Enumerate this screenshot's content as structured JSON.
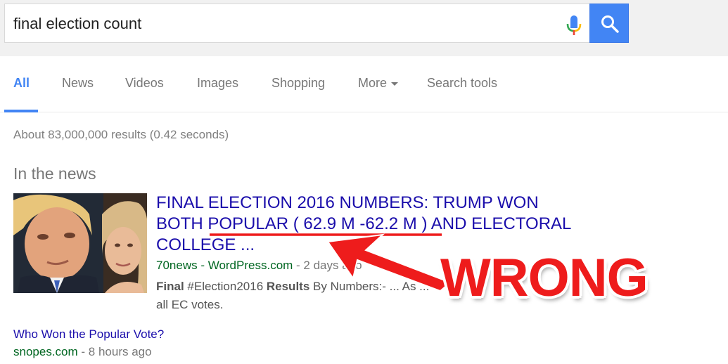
{
  "search": {
    "query": "final election count",
    "mic_icon": "microphone-icon",
    "search_icon": "magnifier-icon",
    "colors": {
      "button": "#4285f4",
      "accent": "#4285f4"
    }
  },
  "tabs": [
    {
      "label": "All",
      "active": true
    },
    {
      "label": "News"
    },
    {
      "label": "Videos"
    },
    {
      "label": "Images"
    },
    {
      "label": "Shopping"
    },
    {
      "label": "More"
    },
    {
      "label": "Search tools"
    }
  ],
  "results_stats": "About 83,000,000 results (0.42 seconds)",
  "in_the_news": {
    "heading": "In the news",
    "top_story": {
      "title_line1": "FINAL ELECTION 2016 NUMBERS: TRUMP WON",
      "title_line2_pre": "BOTH ",
      "title_line2_highlight": "POPULAR ( 62.9 M -62.2 M )",
      "title_line2_post": " AND ELECTORAL",
      "title_line3": "COLLEGE ...",
      "site": "70news - WordPress.com",
      "age": " - 2 days ago",
      "snippet_b1": "Final",
      "snippet_t1": " #Election2016 ",
      "snippet_b2": "Results",
      "snippet_t2": " By Numbers:- ... As ... ",
      "snippet_line2": "all EC votes."
    },
    "second_story": {
      "title": "Who Won the Popular Vote?",
      "site": "snopes.com",
      "age": " - 8 hours ago"
    }
  },
  "annotation": {
    "text": "WRONG",
    "color": "#ee1c1c"
  }
}
